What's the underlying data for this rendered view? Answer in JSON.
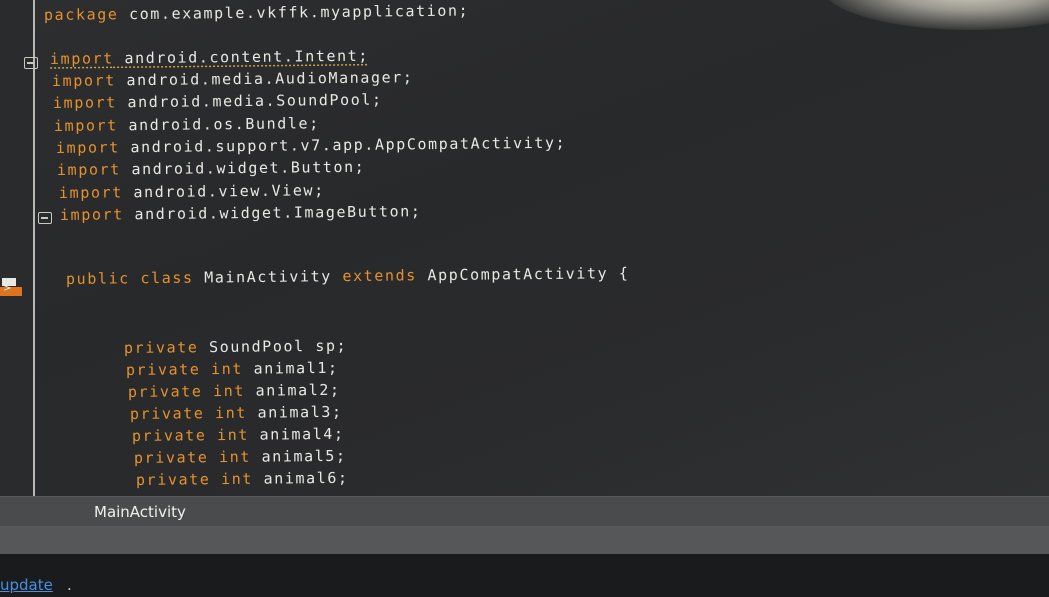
{
  "editor": {
    "lines": {
      "package_kw": "package",
      "package_name": " com.example.vkffk.myapplication;",
      "import_kw": "import",
      "imports": [
        " android.content.Intent;",
        " android.media.AudioManager;",
        " android.media.SoundPool;",
        " android.os.Bundle;",
        " android.support.v7.app.AppCompatActivity;",
        " android.widget.Button;",
        " android.view.View;",
        " android.widget.ImageButton;"
      ],
      "class_public": "public",
      "class_class": "class",
      "class_name": "MainActivity",
      "class_extends": "extends",
      "class_parent": "AppCompatActivity {",
      "private_kw": "private",
      "soundpool_decl": " SoundPool sp;",
      "int_kw": "int",
      "fields": [
        " animal1;",
        " animal2;",
        " animal3;",
        " animal4;",
        " animal5;",
        " animal6;"
      ]
    }
  },
  "tab": {
    "label": "MainActivity"
  },
  "status": {
    "link_text": "update",
    "trailing": "."
  },
  "colors": {
    "keyword": "#e6922c",
    "text": "#e8e8e2",
    "background": "#2b2c2e",
    "link": "#4a8fe0"
  }
}
